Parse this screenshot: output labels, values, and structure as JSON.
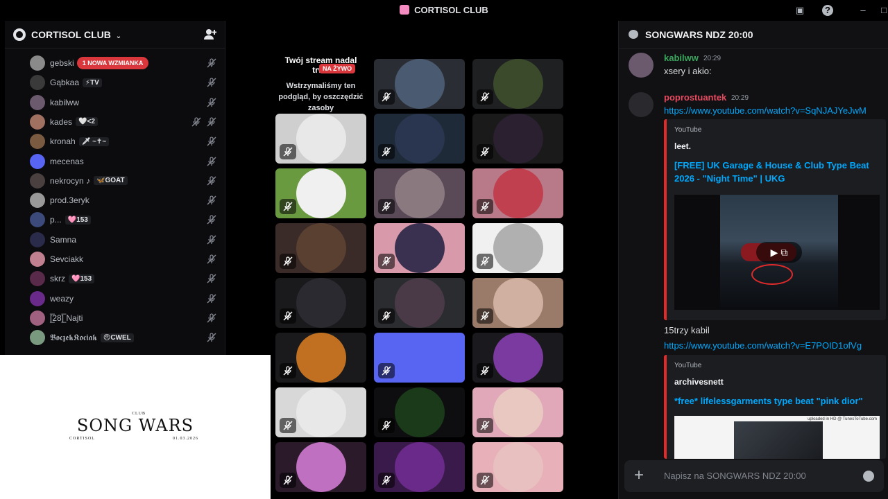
{
  "window": {
    "title": "CORTISOL CLUB"
  },
  "sidebar": {
    "server_name": "CORTISOL CLUB",
    "members": [
      {
        "name": "gebski",
        "mention": "1 NOWA WZMIANKA",
        "color": "#8a8a8a"
      },
      {
        "name": "Gąbkaa",
        "tag": "⚡TV",
        "color": "#3a3a3a"
      },
      {
        "name": "kabilww",
        "color": "#6b5a6e"
      },
      {
        "name": "kades",
        "tag": "🤍<2",
        "color": "#a07060",
        "deafened": true
      },
      {
        "name": "kronah",
        "tag": "🗡 ~✝~",
        "color": "#7a5a40"
      },
      {
        "name": "mecenas",
        "color": "#5865f2"
      },
      {
        "name": "nekrocyn ♪",
        "tag": "🦋GOAT",
        "color": "#4a4040"
      },
      {
        "name": "prod.3eryk",
        "color": "#999999"
      },
      {
        "name": "p...",
        "tag": "🩷153",
        "color": "#3b4a7a"
      },
      {
        "name": "Samna",
        "color": "#2a2a4a"
      },
      {
        "name": "Sevciakk",
        "color": "#c08090"
      },
      {
        "name": "skrz",
        "tag": "🩷153",
        "color": "#5a2a4a"
      },
      {
        "name": "weazy",
        "color": "#6a2a8a"
      },
      {
        "name": "[̲̅28]̲̅ Najti",
        "color": "#a06080"
      },
      {
        "name": "𝕭𝖔𝖈𝖟𝖊𝖐𝕶𝖔𝖈𝖎𝖆𝖐",
        "tag": "😠CWEL",
        "color": "#7a9a80"
      }
    ]
  },
  "stream": {
    "title_text": "Twój stream nadal trwa",
    "live_badge": "NA ŻYWO",
    "body_text": "Wstrzymaliśmy ten podgląd, by oszczędzić zasoby"
  },
  "overlay": {
    "club": "CLUB",
    "title": "SONG WARS",
    "sub_left": "CORTISOL",
    "date": "01.03.2026"
  },
  "chat": {
    "channel": "SONGWARS NDZ 20:00",
    "messages": [
      {
        "author": "kabilww",
        "time": "20:29",
        "color": "#3ba55d",
        "text": "xsery i akio:"
      },
      {
        "author": "poprostuantek",
        "time": "20:29",
        "color": "#e84a5f",
        "link": "https://www.youtube.com/watch?v=SqNJAJYeJwM",
        "embed": {
          "provider": "YouTube",
          "channel": "leet.",
          "title": "[FREE] UK Garage & House & Club Type Beat 2026 - \"Night Time\" | UKG"
        }
      },
      {
        "text": "15trzy kabil",
        "link": "https://www.youtube.com/watch?v=E7POID1ofVg",
        "embed": {
          "provider": "YouTube",
          "channel": "archivesnett",
          "title": "*free* lifelessgarments type beat \"pink dior\"",
          "watermark": "uploaded in HD @ TunesToTube.com"
        }
      }
    ],
    "composer_placeholder": "Napisz na SONGWARS NDZ 20:00"
  },
  "tiles": [
    {
      "bg": "#2a2d33",
      "c": "#4a5a70"
    },
    {
      "bg": "#1f2022",
      "c": "#3a4a2a"
    },
    {
      "bg": "#cfcfcf",
      "c": "#e8e8e8"
    },
    {
      "bg": "#1f2a38",
      "c": "#2a3650"
    },
    {
      "bg": "#1a1a1a",
      "c": "#2a2030"
    },
    {
      "bg": "#6a9a40",
      "c": "#f0f0f0"
    },
    {
      "bg": "#5a4a58",
      "c": "#8a7a80"
    },
    {
      "bg": "#b87a88",
      "c": "#c04050"
    },
    {
      "bg": "#3a2a28",
      "c": "#5a4030"
    },
    {
      "bg": "#d89aaa",
      "c": "#3a3050"
    },
    {
      "bg": "#f0f0f0",
      "c": "#b0b0b0"
    },
    {
      "bg": "#1a1a1c",
      "c": "#2a2a30"
    },
    {
      "bg": "#2a2c30",
      "c": "#4a3a48"
    },
    {
      "bg": "#9a7a68",
      "c": "#d0b0a0"
    },
    {
      "bg": "#1a1a1c",
      "c": "#c07020"
    },
    {
      "bg": "#5865f2",
      "c": "#5865f2"
    },
    {
      "bg": "#1a1a1e",
      "c": "#7a3aa0"
    },
    {
      "bg": "#d8d8d8",
      "c": "#e8e8e8"
    },
    {
      "bg": "#0e0e10",
      "c": "#1a3a1a"
    },
    {
      "bg": "#e0a8b8",
      "c": "#e8c8c0"
    },
    {
      "bg": "#2a1a2a",
      "c": "#c070c0"
    },
    {
      "bg": "#3a1a4a",
      "c": "#6a2a8a"
    },
    {
      "bg": "#e8b0b8",
      "c": "#e8c0c0"
    }
  ]
}
